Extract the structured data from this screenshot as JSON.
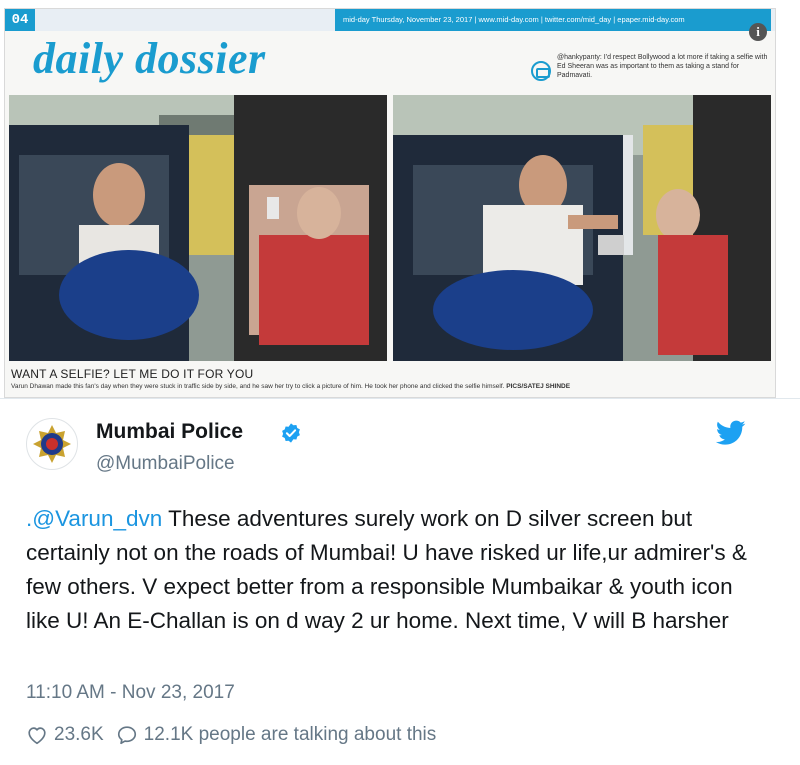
{
  "newspaper": {
    "page_number": "04",
    "masthead": "mid-day Thursday, November 23, 2017 | www.mid-day.com | twitter.com/mid_day | epaper.mid-day.com",
    "section_title": "daily dossier",
    "side_quote": "@hankypanty: I'd respect Bollywood a lot more if taking a selfie with Ed Sheeran was as important to them as taking a stand for Padmavati.",
    "caption_headline": "WANT A SELFIE? LET ME DO IT FOR YOU",
    "caption_text": "Varun Dhawan made this fan's day when they were stuck in traffic side by side, and he saw her try to click a picture of him. He took her phone and clicked the selfie himself.",
    "photo_credit": "PICS/SATEJ SHINDE"
  },
  "tweet": {
    "display_name": "Mumbai Police",
    "handle": "@MumbaiPolice",
    "mention": ".@Varun_dvn",
    "body": " These adventures surely work on D silver screen but certainly not on the roads of Mumbai! U have risked ur life,ur admirer's & few others. V expect better from a responsible Mumbaikar & youth icon like U! An E-Challan is on d way 2 ur home. Next time, V will B harsher",
    "timestamp": "11:10 AM - Nov 23, 2017",
    "likes": "23.6K",
    "talking": "12.1K people are talking about this"
  },
  "icons": {
    "verified": "verified-badge-icon",
    "bird": "twitter-bird-icon",
    "heart": "heart-icon",
    "reply": "speech-bubble-icon",
    "info": "info-icon"
  },
  "colors": {
    "twitter_blue": "#1da1f2",
    "mention": "#1b95e0",
    "muted": "#657786",
    "paper_accent": "#1a9ccf"
  }
}
